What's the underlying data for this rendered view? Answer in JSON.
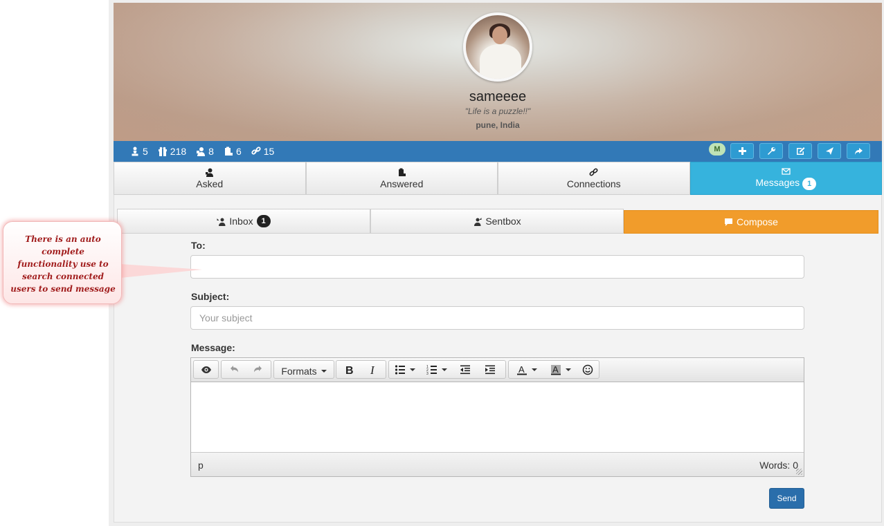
{
  "profile": {
    "username": "sameeee",
    "quote": "\"Life is a puzzle!!\"",
    "location": "pune, India"
  },
  "stats": [
    {
      "icon": "chess-pawn-icon",
      "value": "5"
    },
    {
      "icon": "gift-icon",
      "value": "218"
    },
    {
      "icon": "user-question-icon",
      "value": "8"
    },
    {
      "icon": "clipboard-icon",
      "value": "6"
    },
    {
      "icon": "link-icon",
      "value": "15"
    }
  ],
  "actions": {
    "badge": "M",
    "buttons": [
      "plus-icon",
      "wrench-icon",
      "edit-icon",
      "send-icon",
      "share-icon"
    ]
  },
  "tabs": [
    {
      "label": "Asked",
      "icon": "asked-icon"
    },
    {
      "label": "Answered",
      "icon": "answered-icon"
    },
    {
      "label": "Connections",
      "icon": "link-icon"
    },
    {
      "label": "Messages",
      "icon": "envelope-icon",
      "count": "1",
      "active": true
    }
  ],
  "subtabs": {
    "inbox": {
      "label": "Inbox",
      "count": "1"
    },
    "sentbox": {
      "label": "Sentbox"
    },
    "compose": {
      "label": "Compose",
      "active": true
    }
  },
  "form": {
    "to_label": "To:",
    "to_value": "",
    "subject_label": "Subject:",
    "subject_placeholder": "Your subject",
    "message_label": "Message:",
    "formats_label": "Formats",
    "status_path": "p",
    "word_count": "Words: 0",
    "send_label": "Send"
  },
  "callout": {
    "text": "There is an auto complete functionality use to search connected users to send message"
  },
  "colors": {
    "statbar": "#3279b7",
    "active_tab": "#36b3dd",
    "compose": "#f19c2b",
    "send": "#2a6eab",
    "callout_text": "#a11d1d"
  }
}
